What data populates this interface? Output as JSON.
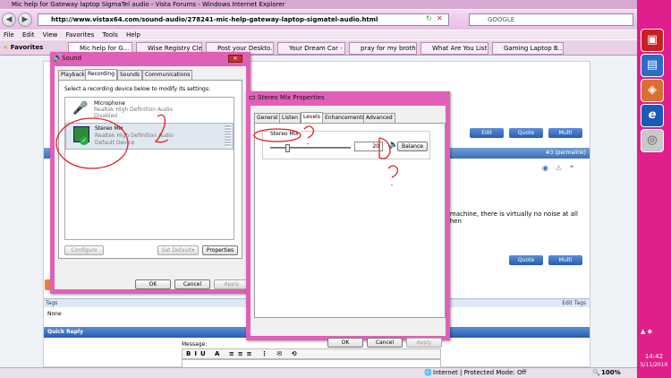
{
  "browser": {
    "title": "Mic help for Gateway laptop SigmaTel audio - Vista Forums - Windows Internet Explorer",
    "url": "http://www.vistax64.com/sound-audio/278241-mic-help-gateway-laptop-sigmatel-audio.html",
    "search_placeholder": "GOOGLE",
    "menu": [
      "File",
      "Edit",
      "View",
      "Favorites",
      "Tools",
      "Help"
    ],
    "favorites_label": "Favorites",
    "tabs": [
      "Mic help for G...",
      "Wise Registry Cle...",
      "Post your Deskto...",
      "Your Dream Car - ...",
      "pray for my broth...",
      "What Are You List...",
      "Gaming Laptop B..."
    ]
  },
  "forum": {
    "edit_label": "Edit",
    "quote_label": "Quote",
    "multi_label": "Multi",
    "post_number": "#3 (permalink)",
    "post_text": "s machine, there is virtually no noise at all when",
    "tags_label": "Tags",
    "tags_value": "None",
    "edit_tags": "Edit Tags",
    "quick_reply": "Quick Reply",
    "message_label": "Message:"
  },
  "statusbar": {
    "zone": "Internet | Protected Mode: Off",
    "zoom": "100%"
  },
  "taskbar": {
    "time": "14:42",
    "date": "5/11/2010"
  },
  "sound_dialog": {
    "title": "Sound",
    "tabs": [
      "Playback",
      "Recording",
      "Sounds",
      "Communications"
    ],
    "instruction": "Select a recording device below to modify its settings:",
    "devices": [
      {
        "name": "Microphone",
        "driver": "Realtek High Definition Audio",
        "status": "Disabled"
      },
      {
        "name": "Stereo Mix",
        "driver": "Realtek High Definition Audio",
        "status": "Default Device"
      }
    ],
    "configure_label": "Configure",
    "set_default_label": "Set Default",
    "properties_label": "Properties",
    "ok_label": "OK",
    "cancel_label": "Cancel",
    "apply_label": "Apply"
  },
  "stereo_dialog": {
    "title": "Stereo Mix Properties",
    "tabs": [
      "General",
      "Listen",
      "Levels",
      "Enhancements",
      "Advanced"
    ],
    "group_label": "Stereo Mix",
    "level_value": "20",
    "level_fraction": 0.2,
    "balance_label": "Balance",
    "ok_label": "OK",
    "cancel_label": "Cancel",
    "apply_label": "Apply"
  }
}
